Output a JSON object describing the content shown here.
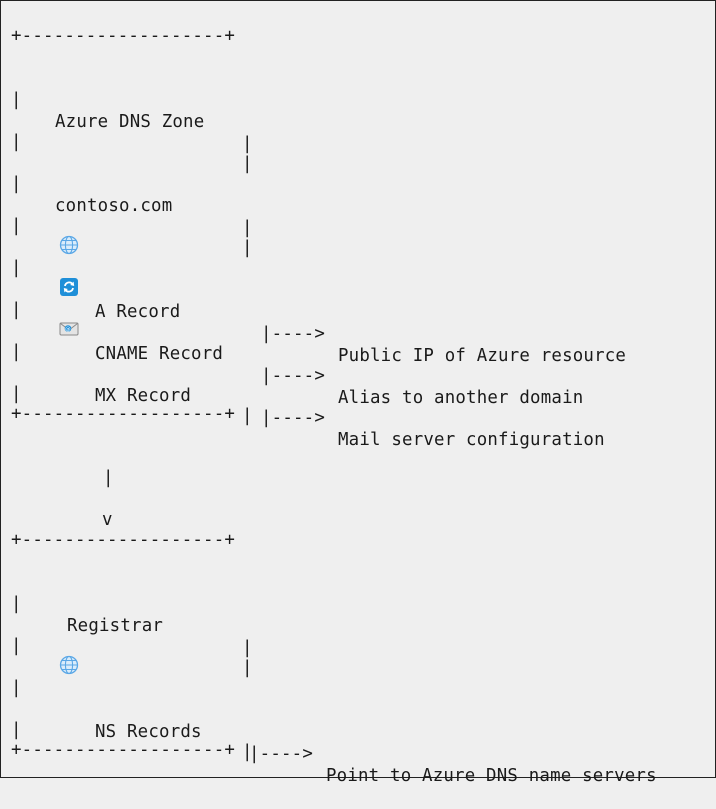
{
  "diagram": {
    "border_line": "+-------------------+",
    "bar": "|",
    "zone": {
      "title": "Azure DNS Zone",
      "domain": "contoso.com",
      "records": [
        {
          "icon": "globe-icon",
          "label": "A Record",
          "arrow": "|---->",
          "target": "Public IP of Azure resource"
        },
        {
          "icon": "sync-icon",
          "label": "CNAME Record",
          "arrow": "|---->",
          "target": "Alias to another domain"
        },
        {
          "icon": "mail-icon",
          "label": "MX Record",
          "arrow": "|---->",
          "target": "Mail server configuration"
        }
      ]
    },
    "connector": {
      "line": "|",
      "arrowhead": "v"
    },
    "registrar": {
      "title": "Registrar",
      "records": [
        {
          "icon": "globe-icon",
          "label": "NS Records",
          "arrow": "|---->",
          "target": "Point to Azure DNS name servers"
        }
      ]
    },
    "colors": {
      "background": "#efefef",
      "text": "#1a1a1a",
      "icon_blue": "#1f8fd8"
    }
  }
}
